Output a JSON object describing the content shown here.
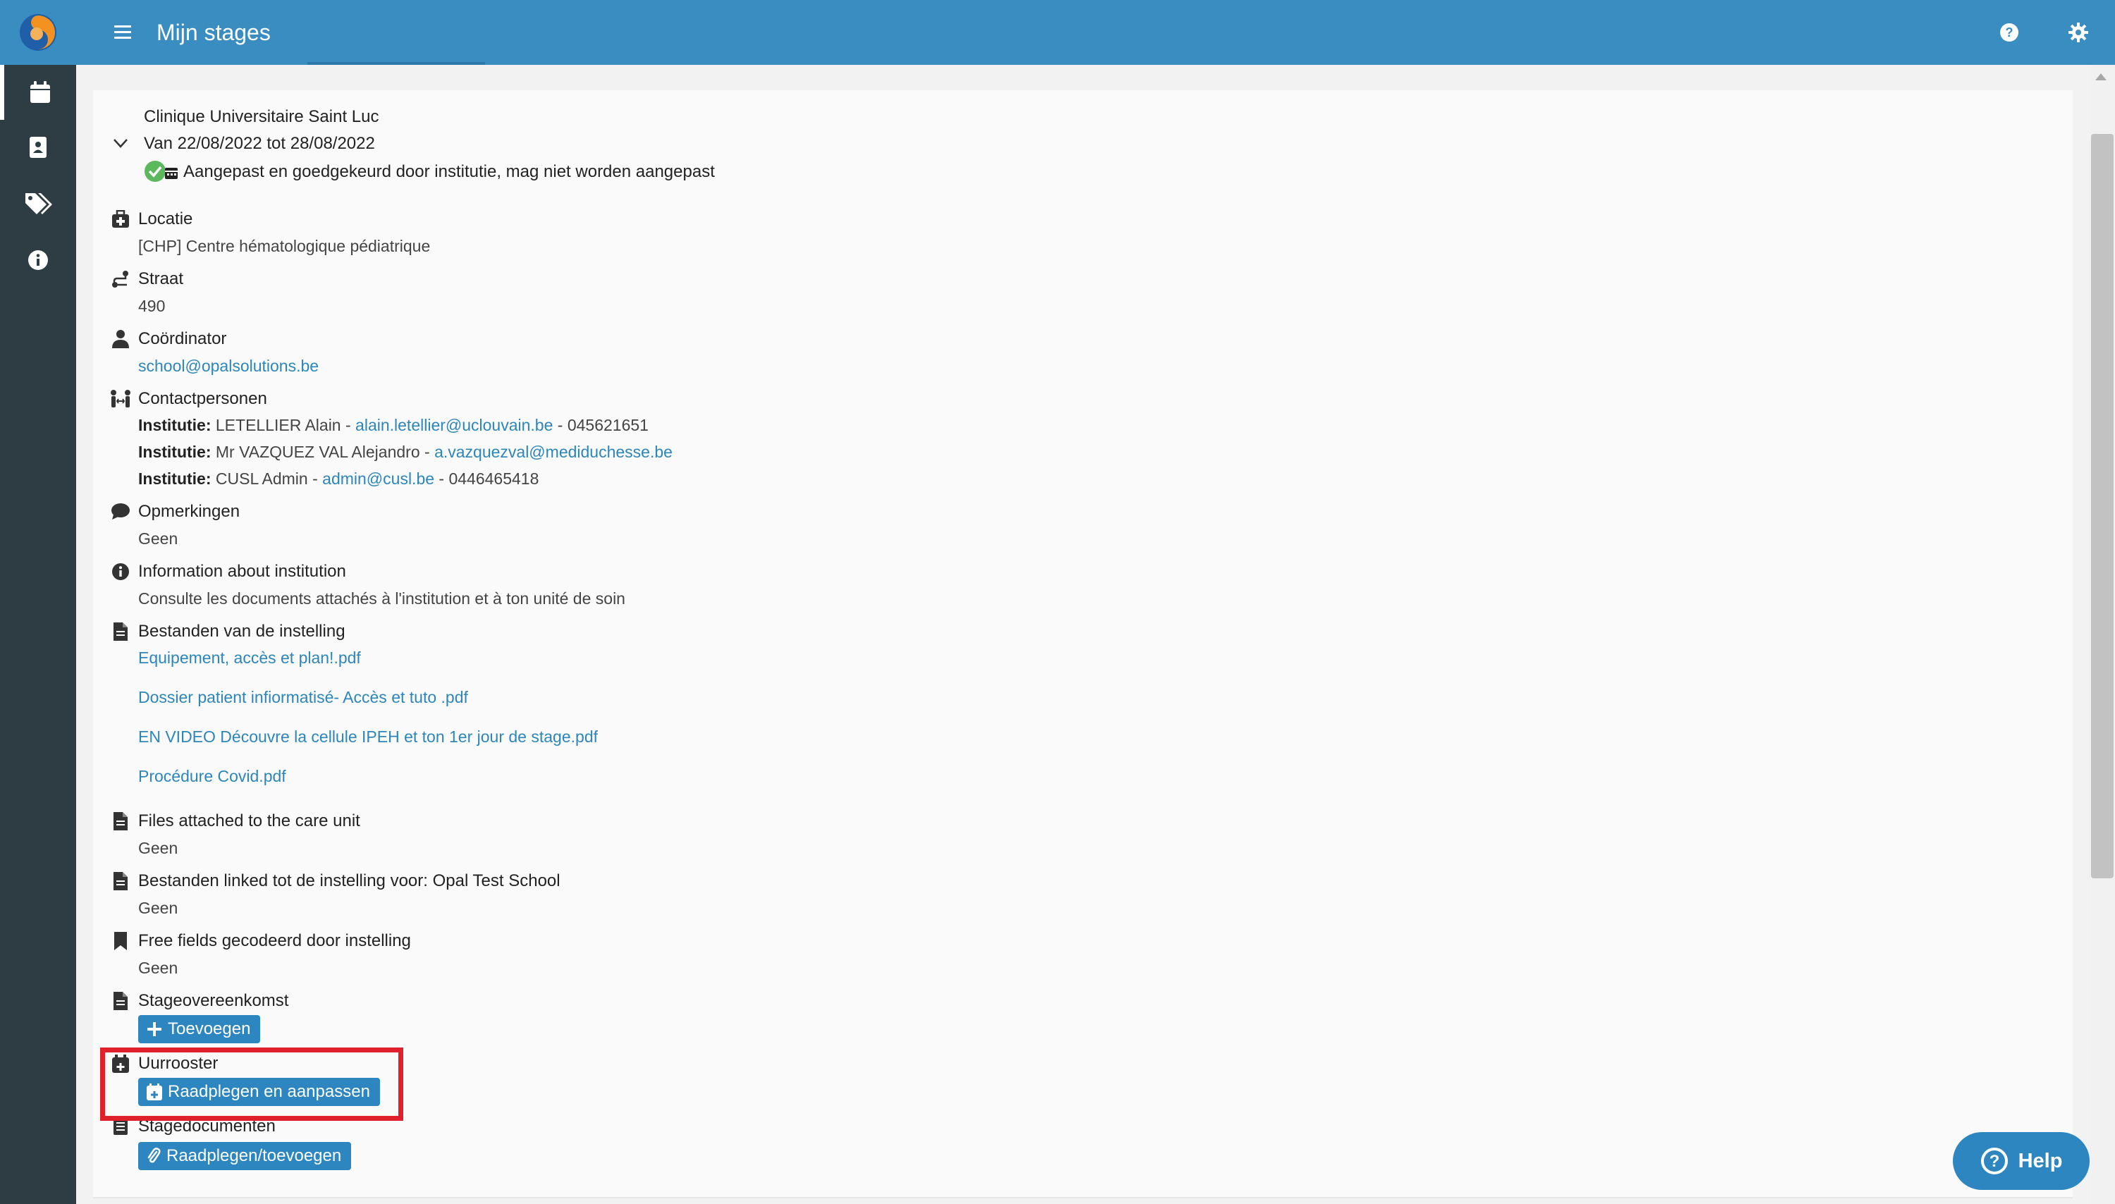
{
  "app": {
    "title": "Mijn stages"
  },
  "sidebar": {
    "items": [
      {
        "icon": "calendar-icon",
        "active": true
      },
      {
        "icon": "contact-card-icon",
        "active": false
      },
      {
        "icon": "tags-icon",
        "active": false
      },
      {
        "icon": "info-icon",
        "active": false
      }
    ]
  },
  "internship": {
    "institution": "Clinique Universitaire Saint Luc",
    "period": "Van 22/08/2022 tot 28/08/2022",
    "status": "Aangepast en goedgekeurd door institutie, mag niet worden aangepast"
  },
  "sections": {
    "location": {
      "title": "Locatie",
      "value": "[CHP] Centre hématologique pédiatrique"
    },
    "street": {
      "title": "Straat",
      "value": "490"
    },
    "coordinator": {
      "title": "Coördinator",
      "email": "school@opalsolutions.be"
    },
    "contacts": {
      "title": "Contactpersonen",
      "items": [
        {
          "label": "Institutie:",
          "name": "LETELLIER Alain -",
          "email": "alain.letellier@uclouvain.be",
          "phone": "- 045621651"
        },
        {
          "label": "Institutie:",
          "name": "Mr VAZQUEZ VAL Alejandro -",
          "email": "a.vazquezval@mediduchesse.be",
          "phone": ""
        },
        {
          "label": "Institutie:",
          "name": "CUSL Admin -",
          "email": "admin@cusl.be",
          "phone": "- 0446465418"
        }
      ]
    },
    "remarks": {
      "title": "Opmerkingen",
      "value": "Geen"
    },
    "info": {
      "title": "Information about institution",
      "value": "Consulte les documents attachés à l'institution et à ton unité de soin"
    },
    "institution_files": {
      "title": "Bestanden van de instelling",
      "files": [
        "Equipement, accès et plan!.pdf",
        "Dossier patient infiormatisé- Accès et tuto .pdf",
        "EN VIDEO Découvre la cellule IPEH et ton 1er jour de stage.pdf",
        "Procédure Covid.pdf"
      ]
    },
    "care_unit_files": {
      "title": "Files attached to the care unit",
      "value": "Geen"
    },
    "linked_files": {
      "title": "Bestanden linked tot de instelling voor: Opal Test School",
      "value": "Geen"
    },
    "free_fields": {
      "title": "Free fields gecodeerd door instelling",
      "value": "Geen"
    },
    "agreement": {
      "title": "Stageovereenkomst",
      "button": "Toevoegen"
    },
    "schedule": {
      "title": "Uurrooster",
      "button": "Raadplegen en aanpassen"
    },
    "documents": {
      "title": "Stagedocumenten",
      "button": "Raadplegen/toevoegen"
    }
  },
  "help_button": {
    "label": "Help"
  },
  "colors": {
    "primary": "#3a8dc1",
    "sidebar": "#2e3c43",
    "link": "#2d86b9",
    "highlight": "#e0202a",
    "success": "#5cb85c"
  }
}
